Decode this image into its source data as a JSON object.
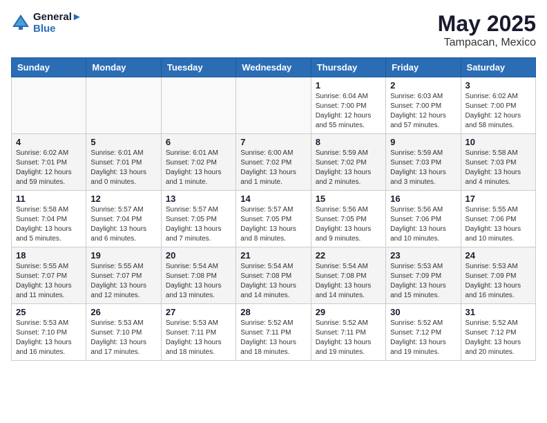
{
  "header": {
    "logo_line1": "General",
    "logo_line2": "Blue",
    "title": "May 2025",
    "subtitle": "Tampacan, Mexico"
  },
  "weekdays": [
    "Sunday",
    "Monday",
    "Tuesday",
    "Wednesday",
    "Thursday",
    "Friday",
    "Saturday"
  ],
  "weeks": [
    [
      {
        "day": "",
        "info": ""
      },
      {
        "day": "",
        "info": ""
      },
      {
        "day": "",
        "info": ""
      },
      {
        "day": "",
        "info": ""
      },
      {
        "day": "1",
        "info": "Sunrise: 6:04 AM\nSunset: 7:00 PM\nDaylight: 12 hours\nand 55 minutes."
      },
      {
        "day": "2",
        "info": "Sunrise: 6:03 AM\nSunset: 7:00 PM\nDaylight: 12 hours\nand 57 minutes."
      },
      {
        "day": "3",
        "info": "Sunrise: 6:02 AM\nSunset: 7:00 PM\nDaylight: 12 hours\nand 58 minutes."
      }
    ],
    [
      {
        "day": "4",
        "info": "Sunrise: 6:02 AM\nSunset: 7:01 PM\nDaylight: 12 hours\nand 59 minutes."
      },
      {
        "day": "5",
        "info": "Sunrise: 6:01 AM\nSunset: 7:01 PM\nDaylight: 13 hours\nand 0 minutes."
      },
      {
        "day": "6",
        "info": "Sunrise: 6:01 AM\nSunset: 7:02 PM\nDaylight: 13 hours\nand 1 minute."
      },
      {
        "day": "7",
        "info": "Sunrise: 6:00 AM\nSunset: 7:02 PM\nDaylight: 13 hours\nand 1 minute."
      },
      {
        "day": "8",
        "info": "Sunrise: 5:59 AM\nSunset: 7:02 PM\nDaylight: 13 hours\nand 2 minutes."
      },
      {
        "day": "9",
        "info": "Sunrise: 5:59 AM\nSunset: 7:03 PM\nDaylight: 13 hours\nand 3 minutes."
      },
      {
        "day": "10",
        "info": "Sunrise: 5:58 AM\nSunset: 7:03 PM\nDaylight: 13 hours\nand 4 minutes."
      }
    ],
    [
      {
        "day": "11",
        "info": "Sunrise: 5:58 AM\nSunset: 7:04 PM\nDaylight: 13 hours\nand 5 minutes."
      },
      {
        "day": "12",
        "info": "Sunrise: 5:57 AM\nSunset: 7:04 PM\nDaylight: 13 hours\nand 6 minutes."
      },
      {
        "day": "13",
        "info": "Sunrise: 5:57 AM\nSunset: 7:05 PM\nDaylight: 13 hours\nand 7 minutes."
      },
      {
        "day": "14",
        "info": "Sunrise: 5:57 AM\nSunset: 7:05 PM\nDaylight: 13 hours\nand 8 minutes."
      },
      {
        "day": "15",
        "info": "Sunrise: 5:56 AM\nSunset: 7:05 PM\nDaylight: 13 hours\nand 9 minutes."
      },
      {
        "day": "16",
        "info": "Sunrise: 5:56 AM\nSunset: 7:06 PM\nDaylight: 13 hours\nand 10 minutes."
      },
      {
        "day": "17",
        "info": "Sunrise: 5:55 AM\nSunset: 7:06 PM\nDaylight: 13 hours\nand 10 minutes."
      }
    ],
    [
      {
        "day": "18",
        "info": "Sunrise: 5:55 AM\nSunset: 7:07 PM\nDaylight: 13 hours\nand 11 minutes."
      },
      {
        "day": "19",
        "info": "Sunrise: 5:55 AM\nSunset: 7:07 PM\nDaylight: 13 hours\nand 12 minutes."
      },
      {
        "day": "20",
        "info": "Sunrise: 5:54 AM\nSunset: 7:08 PM\nDaylight: 13 hours\nand 13 minutes."
      },
      {
        "day": "21",
        "info": "Sunrise: 5:54 AM\nSunset: 7:08 PM\nDaylight: 13 hours\nand 14 minutes."
      },
      {
        "day": "22",
        "info": "Sunrise: 5:54 AM\nSunset: 7:08 PM\nDaylight: 13 hours\nand 14 minutes."
      },
      {
        "day": "23",
        "info": "Sunrise: 5:53 AM\nSunset: 7:09 PM\nDaylight: 13 hours\nand 15 minutes."
      },
      {
        "day": "24",
        "info": "Sunrise: 5:53 AM\nSunset: 7:09 PM\nDaylight: 13 hours\nand 16 minutes."
      }
    ],
    [
      {
        "day": "25",
        "info": "Sunrise: 5:53 AM\nSunset: 7:10 PM\nDaylight: 13 hours\nand 16 minutes."
      },
      {
        "day": "26",
        "info": "Sunrise: 5:53 AM\nSunset: 7:10 PM\nDaylight: 13 hours\nand 17 minutes."
      },
      {
        "day": "27",
        "info": "Sunrise: 5:53 AM\nSunset: 7:11 PM\nDaylight: 13 hours\nand 18 minutes."
      },
      {
        "day": "28",
        "info": "Sunrise: 5:52 AM\nSunset: 7:11 PM\nDaylight: 13 hours\nand 18 minutes."
      },
      {
        "day": "29",
        "info": "Sunrise: 5:52 AM\nSunset: 7:11 PM\nDaylight: 13 hours\nand 19 minutes."
      },
      {
        "day": "30",
        "info": "Sunrise: 5:52 AM\nSunset: 7:12 PM\nDaylight: 13 hours\nand 19 minutes."
      },
      {
        "day": "31",
        "info": "Sunrise: 5:52 AM\nSunset: 7:12 PM\nDaylight: 13 hours\nand 20 minutes."
      }
    ]
  ]
}
